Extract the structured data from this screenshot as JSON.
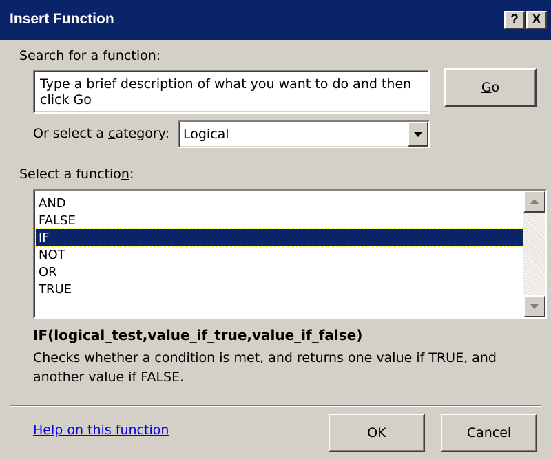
{
  "window": {
    "title": "Insert Function",
    "help_btn": "?",
    "close_btn": "X"
  },
  "search": {
    "label_first": "S",
    "label_rest": "earch for a function:",
    "value": "Type a brief description of what you want to do and then click Go",
    "go_first": "G",
    "go_rest": "o"
  },
  "category": {
    "label_pre": "Or select a ",
    "label_u": "c",
    "label_post": "ategory:",
    "selected": "Logical"
  },
  "functions": {
    "label_pre": "Select a functio",
    "label_u": "n",
    "label_post": ":",
    "items": [
      "AND",
      "FALSE",
      "IF",
      "NOT",
      "OR",
      "TRUE"
    ],
    "selected": "IF"
  },
  "details": {
    "syntax": "IF(logical_test,value_if_true,value_if_false)",
    "description": "Checks whether a condition is met, and returns one value if TRUE, and another value if FALSE."
  },
  "footer": {
    "help_link": "Help on this function",
    "ok": "OK",
    "cancel": "Cancel"
  },
  "colors": {
    "title_bar": "#0a246a",
    "dialog": "#d4d0c8",
    "selection": "#0a246a",
    "link": "#0000ee"
  }
}
